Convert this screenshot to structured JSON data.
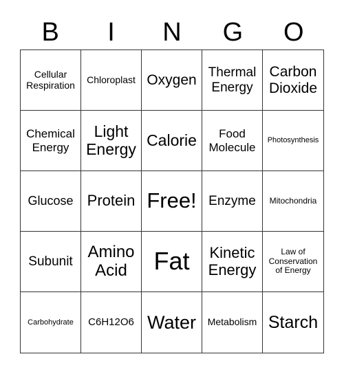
{
  "header": {
    "letters": [
      "B",
      "I",
      "N",
      "G",
      "O"
    ]
  },
  "cells": [
    {
      "text": "Cellular Respiration",
      "size": 14
    },
    {
      "text": "Chloroplast",
      "size": 14
    },
    {
      "text": "Oxygen",
      "size": 21
    },
    {
      "text": "Thermal Energy",
      "size": 19
    },
    {
      "text": "Carbon Dioxide",
      "size": 21
    },
    {
      "text": "Chemical Energy",
      "size": 17
    },
    {
      "text": "Light Energy",
      "size": 23
    },
    {
      "text": "Calorie",
      "size": 23
    },
    {
      "text": "Food Molecule",
      "size": 17
    },
    {
      "text": "Photosynthesis",
      "size": 11
    },
    {
      "text": "Glucose",
      "size": 18
    },
    {
      "text": "Protein",
      "size": 22
    },
    {
      "text": "Free!",
      "size": 31
    },
    {
      "text": "Enzyme",
      "size": 19
    },
    {
      "text": "Mitochondria",
      "size": 12
    },
    {
      "text": "Subunit",
      "size": 19
    },
    {
      "text": "Amino Acid",
      "size": 24
    },
    {
      "text": "Fat",
      "size": 36
    },
    {
      "text": "Kinetic Energy",
      "size": 22
    },
    {
      "text": "Law of Conservation of Energy",
      "size": 12
    },
    {
      "text": "Carbohydrate",
      "size": 11
    },
    {
      "text": "C6H12O6",
      "size": 15
    },
    {
      "text": "Water",
      "size": 27
    },
    {
      "text": "Metabolism",
      "size": 14
    },
    {
      "text": "Starch",
      "size": 25
    }
  ]
}
